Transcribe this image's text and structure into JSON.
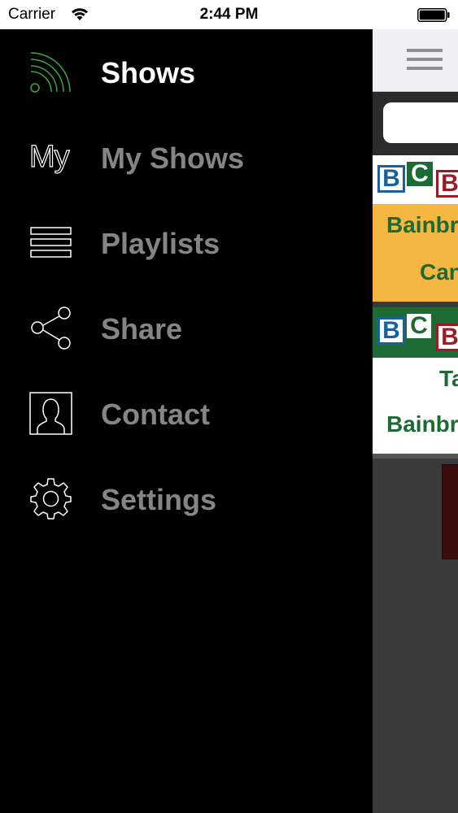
{
  "status_bar": {
    "carrier": "Carrier",
    "time": "2:44 PM"
  },
  "menu": {
    "items": [
      {
        "label": "Shows",
        "icon": "rss-feed-icon",
        "active": true
      },
      {
        "label": "My Shows",
        "icon": "my-text-icon",
        "icon_text": "My",
        "active": false
      },
      {
        "label": "Playlists",
        "icon": "list-icon",
        "active": false
      },
      {
        "label": "Share",
        "icon": "share-icon",
        "active": false
      },
      {
        "label": "Contact",
        "icon": "contact-icon",
        "active": false
      },
      {
        "label": "Settings",
        "icon": "gear-icon",
        "active": false
      }
    ]
  },
  "content": {
    "card1": {
      "logo": [
        "B",
        "C",
        "B"
      ],
      "line1": "Bainbr",
      "line2": "Can"
    },
    "card2": {
      "logo": [
        "B",
        "C",
        "B"
      ],
      "line1": "Ta",
      "line2": "Bainbr"
    }
  },
  "colors": {
    "active_icon": "#3aa83a",
    "inactive_label": "#858585",
    "card1_band": "#f6b642",
    "card_text_green": "#1c6b35",
    "logo_blue": "#1a5fa0",
    "logo_green": "#1c6b35",
    "logo_red": "#9b1c22"
  }
}
